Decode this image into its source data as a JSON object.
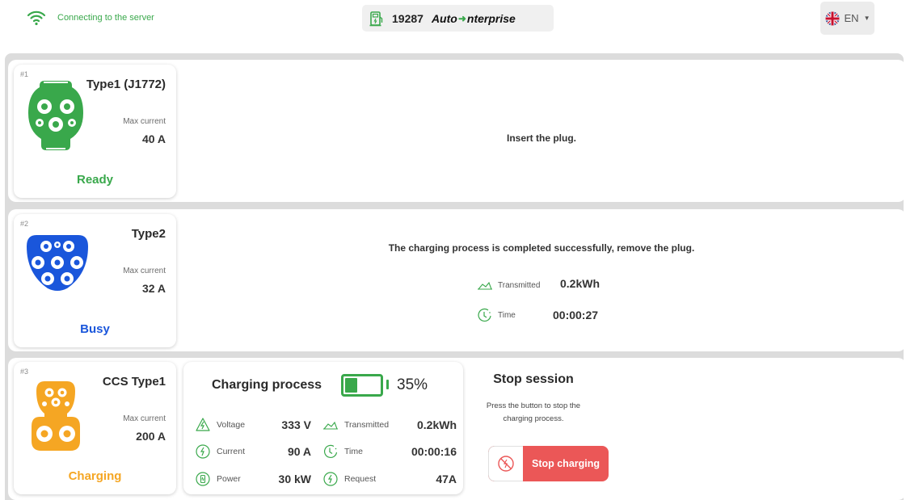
{
  "header": {
    "connection_text": "Connecting to the server",
    "station_id": "19287",
    "brand_prefix": "Auto",
    "brand_suffix": "nterprise",
    "language": "EN"
  },
  "connectors": [
    {
      "number": "#1",
      "type": "Type1 (J1772)",
      "max_current_label": "Max current",
      "max_current": "40 A",
      "status": "Ready",
      "status_color": "#39a84b",
      "plug_color": "#39a84b",
      "message": "Insert the plug."
    },
    {
      "number": "#2",
      "type": "Type2",
      "max_current_label": "Max current",
      "max_current": "32 A",
      "status": "Busy",
      "status_color": "#1a56db",
      "plug_color": "#1a56db",
      "message": "The charging process is completed successfully, remove the plug.",
      "transmitted_label": "Transmitted",
      "transmitted": "0.2kWh",
      "time_label": "Time",
      "time": "00:00:27"
    },
    {
      "number": "#3",
      "type": "CCS Type1",
      "max_current_label": "Max current",
      "max_current": "200 A",
      "status": "Charging",
      "status_color": "#f5a623",
      "plug_color": "#f5a623"
    }
  ],
  "charging_process": {
    "title": "Charging process",
    "battery_percent": "35%",
    "battery_level": 0.35,
    "voltage_label": "Voltage",
    "voltage": "333 V",
    "current_label": "Current",
    "current": "90 A",
    "power_label": "Power",
    "power": "30 kW",
    "transmitted_label": "Transmitted",
    "transmitted": "0.2kWh",
    "time_label": "Time",
    "time": "00:00:16",
    "request_label": "Request",
    "request": "47A"
  },
  "stop_session": {
    "title": "Stop session",
    "description": "Press the button to stop the charging process.",
    "button_label": "Stop charging"
  },
  "colors": {
    "accent_green": "#39a84b",
    "stop_red": "#eb5757"
  }
}
